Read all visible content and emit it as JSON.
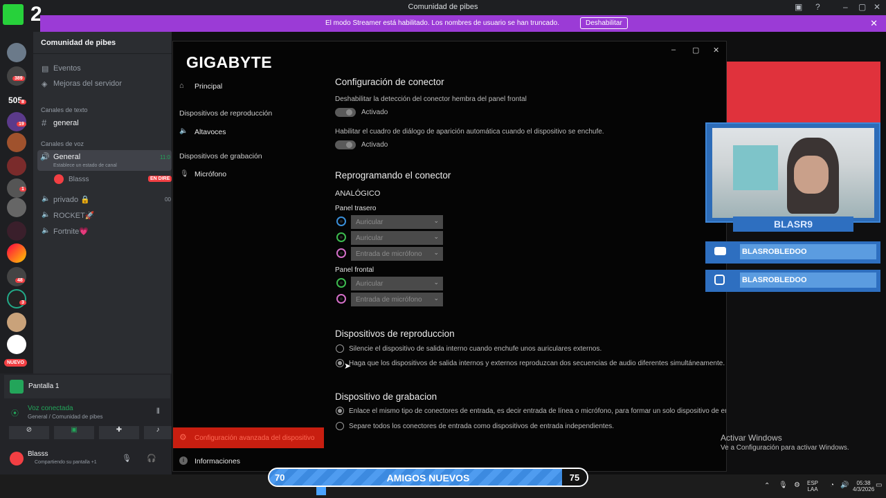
{
  "titlebar": {
    "title": "Comunidad de pibes",
    "overlay_number": "2"
  },
  "streamer_banner": {
    "message": "El modo Streamer está habilitado. Los nombres de usuario se han truncado.",
    "button": "Deshabilitar"
  },
  "rail": {
    "badges": [
      "389",
      "8",
      "19",
      "1",
      "48",
      "3"
    ],
    "new_label": "NUEVO",
    "server_505": "505"
  },
  "channels": {
    "server_name": "Comunidad de pibes",
    "events": "Eventos",
    "boosts": "Mejoras del servidor",
    "text_category": "Canales de texto",
    "general_text": "general",
    "voice_category": "Canales de voz",
    "voice_general": "General",
    "voice_general_time": "11:0",
    "voice_status": "Establece un estado de canal",
    "member": "Blasss",
    "live_badge": "EN DIRE",
    "privado": "privado 🔒",
    "privado_time": "00",
    "rocket": "ROCKET🚀",
    "fortnite": "Fortnite💗"
  },
  "userpanel": {
    "screen_share": "Pantalla 1",
    "voice_connected": "Voz conectada",
    "voice_location": "General / Comunidad de pibes",
    "username": "Blasss",
    "status": "Compartiendo su pantalla +1"
  },
  "gigabyte": {
    "brand": "GIGABYTE",
    "nav": {
      "principal": "Principal",
      "playback_head": "Dispositivos de reproducción",
      "speakers": "Altavoces",
      "recording_head": "Dispositivos de grabación",
      "microphone": "Micrófono",
      "advanced": "Configuración avanzada del dispositivo",
      "info": "Informaciones"
    },
    "connector": {
      "title": "Configuración de conector",
      "opt1": "Deshabilitar la detección del conector hembra del panel frontal",
      "opt1_state": "Activado",
      "opt2": "Habilitar el cuadro de diálogo de aparición automática cuando el dispositivo se enchufe.",
      "opt2_state": "Activado"
    },
    "retasking": {
      "title": "Reprogramando el conector",
      "analog": "ANALÓGICO",
      "rear_panel": "Panel trasero",
      "rear": [
        "Auricular",
        "Auricular",
        "Entrada de micrófono"
      ],
      "front_panel": "Panel frontal",
      "front": [
        "Auricular",
        "Entrada de micrófono"
      ]
    },
    "playback": {
      "title": "Dispositivos de reproduccion",
      "opt1": "Silencie el dispositivo de salida interno cuando enchufe unos auriculares externos.",
      "opt2": "Haga que los dispositivos de salida internos y externos reproduzcan dos secuencias de audio diferentes simultáneamente.",
      "selected": 2
    },
    "recording": {
      "title": "Dispositivo de grabacion",
      "opt1": "Enlace el mismo tipo de conectores de entrada, es decir entrada de línea o micrófono, para formar un solo dispositivo de ent",
      "opt2": "Separe todos los conectores de entrada como dispositivos de entrada independientes.",
      "selected": 1
    }
  },
  "overlay": {
    "cam_name": "BLASR9",
    "youtube": "BLASROBLEDOO",
    "instagram": "BLASROBLEDOO",
    "goal_left": "70",
    "goal_text": "AMIGOS NUEVOS",
    "goal_right": "75",
    "goal_progress": 0.93
  },
  "activate": {
    "title": "Activar Windows",
    "sub": "Ve a Configuración para activar Windows."
  },
  "taskbar": {
    "lang1": "ESP",
    "lang2": "LAA",
    "time": "05:38",
    "date": "4/3/2026"
  },
  "colors": {
    "accent": "#c81e10",
    "banner": "#9b3bd6",
    "discord_green": "#23a55a"
  }
}
